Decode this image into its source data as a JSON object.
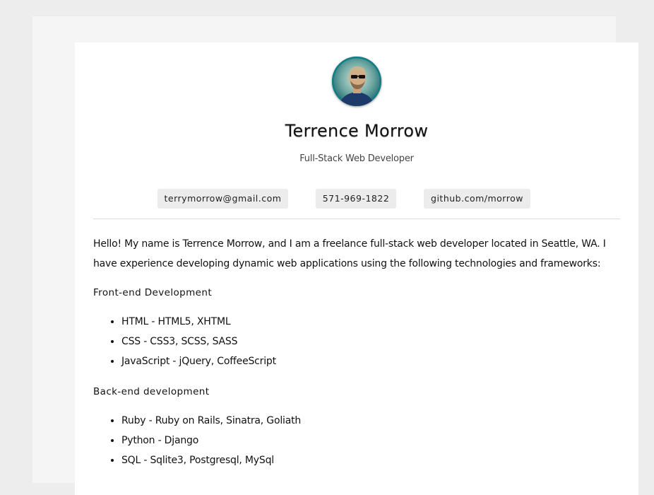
{
  "profile": {
    "name": "Terrence Morrow",
    "role": "Full-Stack Web Developer"
  },
  "contacts": {
    "email": "terrymorrow@gmail.com",
    "phone": "571-969-1822",
    "github": "github.com/morrow"
  },
  "intro": "Hello! My name is Terrence Morrow, and I am a freelance full-stack web developer located in Seattle, WA. I have experience developing dynamic web applications using the following technologies and frameworks:",
  "sections": [
    {
      "title": "Front-end Development",
      "items": [
        "HTML - HTML5, XHTML",
        "CSS - CSS3, SCSS, SASS",
        "JavaScript - jQuery, CoffeeScript"
      ]
    },
    {
      "title": "Back-end development",
      "items": [
        "Ruby - Ruby on Rails, Sinatra, Goliath",
        "Python - Django",
        "SQL - Sqlite3, Postgresql, MySql"
      ]
    }
  ],
  "colors": {
    "page_background": "#ededed",
    "card_background": "#ffffff",
    "contact_pill": "#ececec",
    "divider": "#dcdcdc",
    "avatar_ring": "#0f7f86"
  }
}
